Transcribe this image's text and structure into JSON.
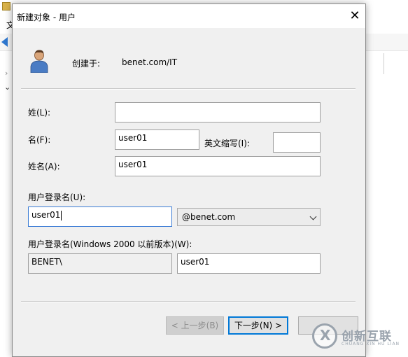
{
  "background_window": {
    "title_fragment": "...",
    "menu_fragment": "文"
  },
  "dialog": {
    "title": "新建对象 - 用户",
    "close_glyph": "✕",
    "created_in_label": "创建于:",
    "created_in_value": "benet.com/IT"
  },
  "form": {
    "last_name": {
      "label": "姓(L):",
      "value": ""
    },
    "first_name": {
      "label": "名(F):",
      "value": "user01"
    },
    "initials": {
      "label": "英文缩写(I):",
      "value": ""
    },
    "full_name": {
      "label": "姓名(A):",
      "value": "user01"
    },
    "logon_name": {
      "label": "用户登录名(U):",
      "value": "user01"
    },
    "domain_suffix": {
      "selected": "@benet.com"
    },
    "pre2000_logon": {
      "label": "用户登录名(Windows 2000 以前版本)(W):",
      "domain": "BENET\\",
      "value": "user01"
    }
  },
  "buttons": {
    "back": "< 上一步(B)",
    "next": "下一步(N) >"
  },
  "watermark": {
    "text": "创新互联",
    "sub": "CHUANG XIN HU LIAN"
  },
  "icons": {
    "user": "user-icon",
    "close": "close-icon",
    "dropdown": "chevron-down-icon"
  }
}
